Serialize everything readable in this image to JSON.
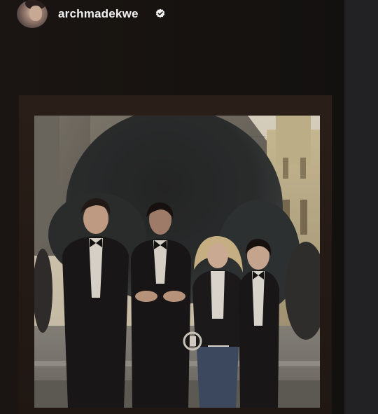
{
  "post": {
    "username": "archmadekwe",
    "verified": true,
    "avatar_icon": "profile-avatar",
    "badge_icon": "verified-badge-icon"
  },
  "media": {
    "type": "polaroid-photo",
    "frame_color": "#241a15",
    "background_color": "#16120f"
  }
}
